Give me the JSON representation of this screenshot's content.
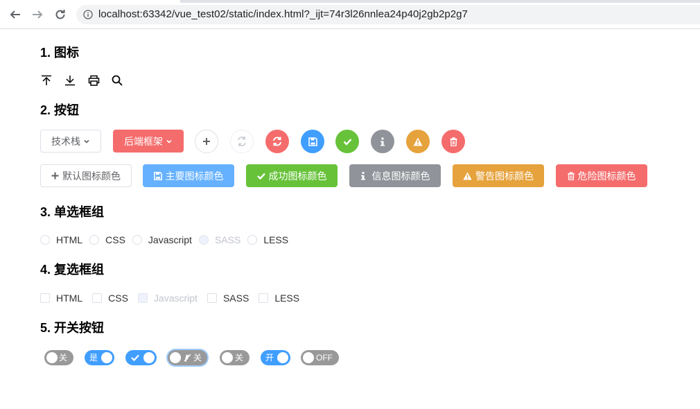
{
  "browser": {
    "url": "localhost:63342/vue_test02/static/index.html?_ijt=74r3l26nnlea24p40j2gb2p2g7",
    "back_icon": "arrow-left-icon",
    "forward_icon": "arrow-right-icon",
    "reload_icon": "reload-icon",
    "info_icon": "info-icon"
  },
  "sections": {
    "icons": "1. 图标",
    "buttons": "2. 按钮",
    "radios": "3. 单选框组",
    "checkboxes": "4. 复选框组",
    "switches": "5. 开关按钮"
  },
  "icon_row": [
    "upload-to-top-icon",
    "download-icon",
    "printer-icon",
    "search-icon"
  ],
  "dropdowns": {
    "tech_stack": "技术栈",
    "backend": "后端框架"
  },
  "round_buttons": [
    {
      "icon": "plus-icon",
      "color": "#ffffff"
    },
    {
      "icon": "refresh-icon",
      "color": "#ffffff",
      "disabled": true
    },
    {
      "icon": "sync-icon",
      "color": "#f56c6c"
    },
    {
      "icon": "save-icon",
      "color": "#409eff"
    },
    {
      "icon": "check-icon",
      "color": "#67c23a"
    },
    {
      "icon": "info-icon",
      "color": "#909399"
    },
    {
      "icon": "warning-icon",
      "color": "#e6a23c"
    },
    {
      "icon": "trash-icon",
      "color": "#f56c6c"
    }
  ],
  "icon_buttons": {
    "default": "默认图标颜色",
    "primary": "主要图标颜色",
    "success": "成功图标颜色",
    "info": "信息图标颜色",
    "warning": "警告图标颜色",
    "danger": "危险图标颜色"
  },
  "radios": [
    {
      "label": "HTML",
      "disabled": false
    },
    {
      "label": "CSS",
      "disabled": false
    },
    {
      "label": "Javascript",
      "disabled": false
    },
    {
      "label": "SASS",
      "disabled": true
    },
    {
      "label": "LESS",
      "disabled": false
    }
  ],
  "checkboxes": [
    {
      "label": "HTML",
      "disabled": false
    },
    {
      "label": "CSS",
      "disabled": false
    },
    {
      "label": "Javascript",
      "disabled": true
    },
    {
      "label": "SASS",
      "disabled": false
    },
    {
      "label": "LESS",
      "disabled": false
    }
  ],
  "switches": [
    {
      "text": "关",
      "on": false
    },
    {
      "text": "是",
      "on": true
    },
    {
      "text": "",
      "on": true,
      "icon": "check-icon"
    },
    {
      "text": "关",
      "on": false,
      "icon": "mute-icon",
      "focused": true
    },
    {
      "text": "关",
      "on": false
    },
    {
      "text": "开",
      "on": true
    },
    {
      "text": "OFF",
      "on": false
    }
  ],
  "colors": {
    "primary": "#409eff",
    "primary_light": "#66b1ff",
    "success": "#67c23a",
    "info": "#909399",
    "warning": "#e6a23c",
    "danger": "#f56c6c",
    "switch_off": "#999999"
  }
}
